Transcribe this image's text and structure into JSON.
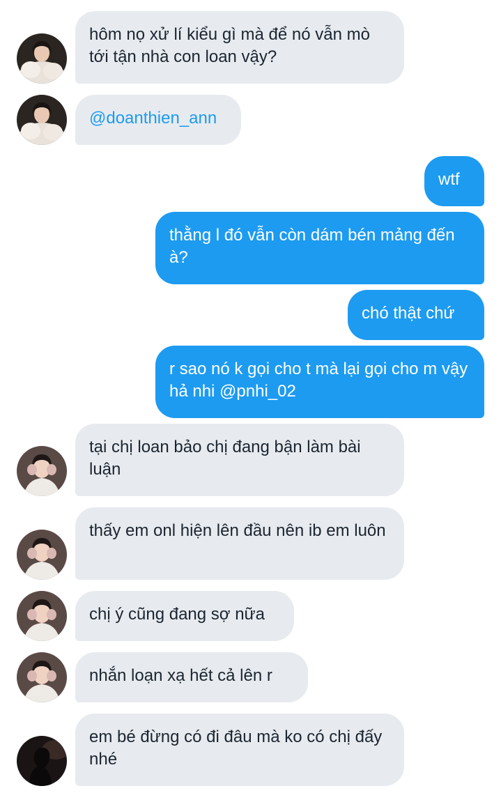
{
  "messages": [
    {
      "side": "incoming",
      "sender": "a",
      "text": "hôm nọ xử lí kiểu gì mà để nó vẫn mò tới tận nhà con loan vậy?"
    },
    {
      "side": "incoming",
      "sender": "a",
      "text": "@doanthien_ann"
    },
    {
      "side": "outgoing",
      "text": "wtf"
    },
    {
      "side": "outgoing",
      "text": "thằng l đó vẫn còn dám bén mảng đến à?"
    },
    {
      "side": "outgoing",
      "text": "chó thật chứ"
    },
    {
      "side": "outgoing",
      "text": "r sao nó k gọi cho t mà lại gọi cho m vậy hả nhi @pnhi_02"
    },
    {
      "side": "incoming",
      "sender": "b",
      "text": "tại chị loan bảo chị đang bận làm bài luận"
    },
    {
      "side": "incoming",
      "sender": "b",
      "text": "thấy em onl hiện lên đầu nên ib em luôn"
    },
    {
      "side": "incoming",
      "sender": "b",
      "text": "chị ý cũng đang sợ nữa"
    },
    {
      "side": "incoming",
      "sender": "b",
      "text": "nhắn loạn xạ hết cả lên r"
    },
    {
      "side": "incoming",
      "sender": "c",
      "text": "em bé đừng có đi đâu mà ko có chị đấy nhé"
    }
  ],
  "colors": {
    "incoming_bubble": "#e7ebef",
    "incoming_text": "#1c2530",
    "outgoing_bubble": "#1d9bf0",
    "outgoing_text": "#ffffff",
    "mention": "#1d9bf0"
  },
  "avatars": {
    "a": "avatar-white-fur-icon",
    "b": "avatar-earmuffs-icon",
    "c": "avatar-silhouette-icon"
  }
}
